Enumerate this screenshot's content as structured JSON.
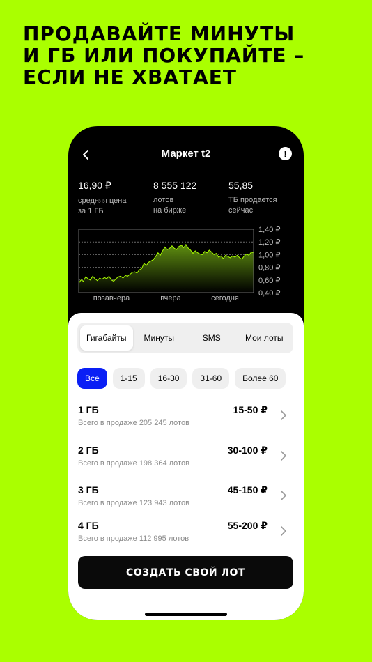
{
  "headline": {
    "line1": "ПРОДАВАЙТЕ МИНУТЫ",
    "line2": "И ГБ ИЛИ ПОКУПАЙТЕ –",
    "line3": "ЕСЛИ НЕ ХВАТАЕТ"
  },
  "header": {
    "back_icon": "chevron-left-icon",
    "title": "Маркет t2",
    "info_icon": "info-icon",
    "info_glyph": "!"
  },
  "stats": [
    {
      "value": "16,90 ₽",
      "label_1": "средняя цена",
      "label_2": "за 1 ГБ"
    },
    {
      "value": "8 555 122",
      "label_1": "лотов",
      "label_2": "на бирже"
    },
    {
      "value": "55,85",
      "label_1": "ТБ продается",
      "label_2": "сейчас"
    }
  ],
  "chart_data": {
    "type": "area",
    "y_ticks": [
      "1,40 ₽",
      "1,20 ₽",
      "1,00 ₽",
      "0,80 ₽",
      "0,60 ₽",
      "0,40 ₽"
    ],
    "ylim": [
      0.4,
      1.4
    ],
    "x_ticks": [
      "позавчера",
      "вчера",
      "сегодня"
    ],
    "values": [
      0.55,
      0.6,
      0.58,
      0.65,
      0.62,
      0.6,
      0.66,
      0.62,
      0.59,
      0.63,
      0.61,
      0.64,
      0.62,
      0.66,
      0.6,
      0.58,
      0.62,
      0.65,
      0.66,
      0.63,
      0.67,
      0.66,
      0.69,
      0.72,
      0.73,
      0.71,
      0.76,
      0.78,
      0.86,
      0.83,
      0.88,
      0.9,
      0.92,
      0.97,
      1.03,
      0.99,
      1.06,
      1.12,
      1.08,
      1.1,
      1.14,
      1.1,
      1.08,
      1.13,
      1.15,
      1.11,
      1.16,
      1.1,
      1.07,
      1.02,
      1.06,
      1.03,
      1.01,
      1.0,
      1.05,
      1.03,
      1.07,
      1.04,
      1.0,
      1.02,
      0.96,
      0.98,
      0.94,
      0.99,
      0.97,
      0.95,
      0.98,
      0.96,
      0.99,
      0.95,
      0.93,
      0.98,
      1.01,
      0.99,
      1.04,
      1.03
    ],
    "grid": "dashed",
    "colors": {
      "fill_top": "#5f8f10",
      "fill_bottom": "#000000",
      "line": "#aaff00"
    }
  },
  "tabs": [
    "Гигабайты",
    "Минуты",
    "SMS",
    "Мои лоты"
  ],
  "active_tab": 0,
  "filters": [
    "Все",
    "1-15",
    "16-30",
    "31-60",
    "Более 60"
  ],
  "active_filter": 0,
  "lots": [
    {
      "title": "1 ГБ",
      "subtitle": "Всего в продаже 205 245 лотов",
      "price": "15-50 ₽"
    },
    {
      "title": "2 ГБ",
      "subtitle": "Всего в продаже 198 364 лотов",
      "price": "30-100 ₽"
    },
    {
      "title": "3 ГБ",
      "subtitle": "Всего в продаже 123 943 лотов",
      "price": "45-150 ₽"
    },
    {
      "title": "4 ГБ",
      "subtitle": "Всего в продаже 112 995 лотов",
      "price": "55-200 ₽"
    }
  ],
  "row_chevron_icon": "chevron-right-icon",
  "cta_label": "СОЗДАТЬ СВОЙ ЛОТ",
  "colors": {
    "background": "#aaff00",
    "accent": "#0a1ff5",
    "phone": "#000000"
  }
}
